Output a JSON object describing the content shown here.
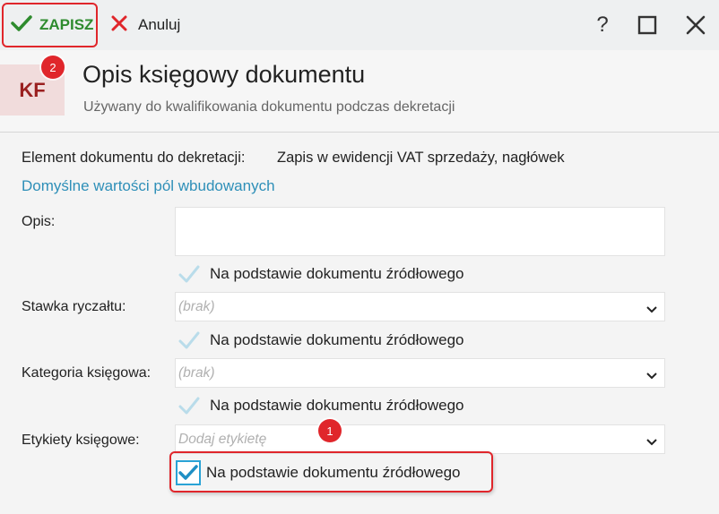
{
  "toolbar": {
    "save_label": "ZAPISZ",
    "cancel_label": "Anuluj",
    "help_label": "?"
  },
  "header": {
    "badge": "KF",
    "title": "Opis księgowy dokumentu",
    "subtitle": "Używany do kwalifikowania dokumentu podczas dekretacji"
  },
  "annotations": {
    "step1": "1",
    "step2": "2"
  },
  "form": {
    "element_label": "Element dokumentu do dekretacji:",
    "element_value": "Zapis w ewidencji VAT sprzedaży, nagłówek",
    "defaults_link": "Domyślne wartości pól wbudowanych",
    "fields": [
      {
        "label": "Opis:",
        "type": "textarea",
        "value": "",
        "source_checkbox": "Na podstawie dokumentu źródłowego",
        "checked": false
      },
      {
        "label": "Stawka ryczałtu:",
        "type": "select",
        "placeholder": "(brak)",
        "source_checkbox": "Na podstawie dokumentu źródłowego",
        "checked": false
      },
      {
        "label": "Kategoria księgowa:",
        "type": "select",
        "placeholder": "(brak)",
        "source_checkbox": "Na podstawie dokumentu źródłowego",
        "checked": false
      },
      {
        "label": "Etykiety księgowe:",
        "type": "select",
        "placeholder": "Dodaj etykietę",
        "source_checkbox": "Na podstawie dokumentu źródłowego",
        "checked": true
      }
    ]
  },
  "colors": {
    "accent_red": "#e0262b",
    "save_green": "#2e8b2e",
    "link_blue": "#2e8fb8",
    "checkbox_blue": "#2aa3d6",
    "badge_bg": "#f1dcdc",
    "badge_text": "#9a1f1f"
  },
  "icons": {
    "save": "checkmark-icon",
    "cancel": "x-icon",
    "help": "question-icon",
    "maximize": "square-icon",
    "close": "close-icon",
    "dropdown": "chevron-down-icon",
    "checkbox": "checkmark-icon"
  }
}
